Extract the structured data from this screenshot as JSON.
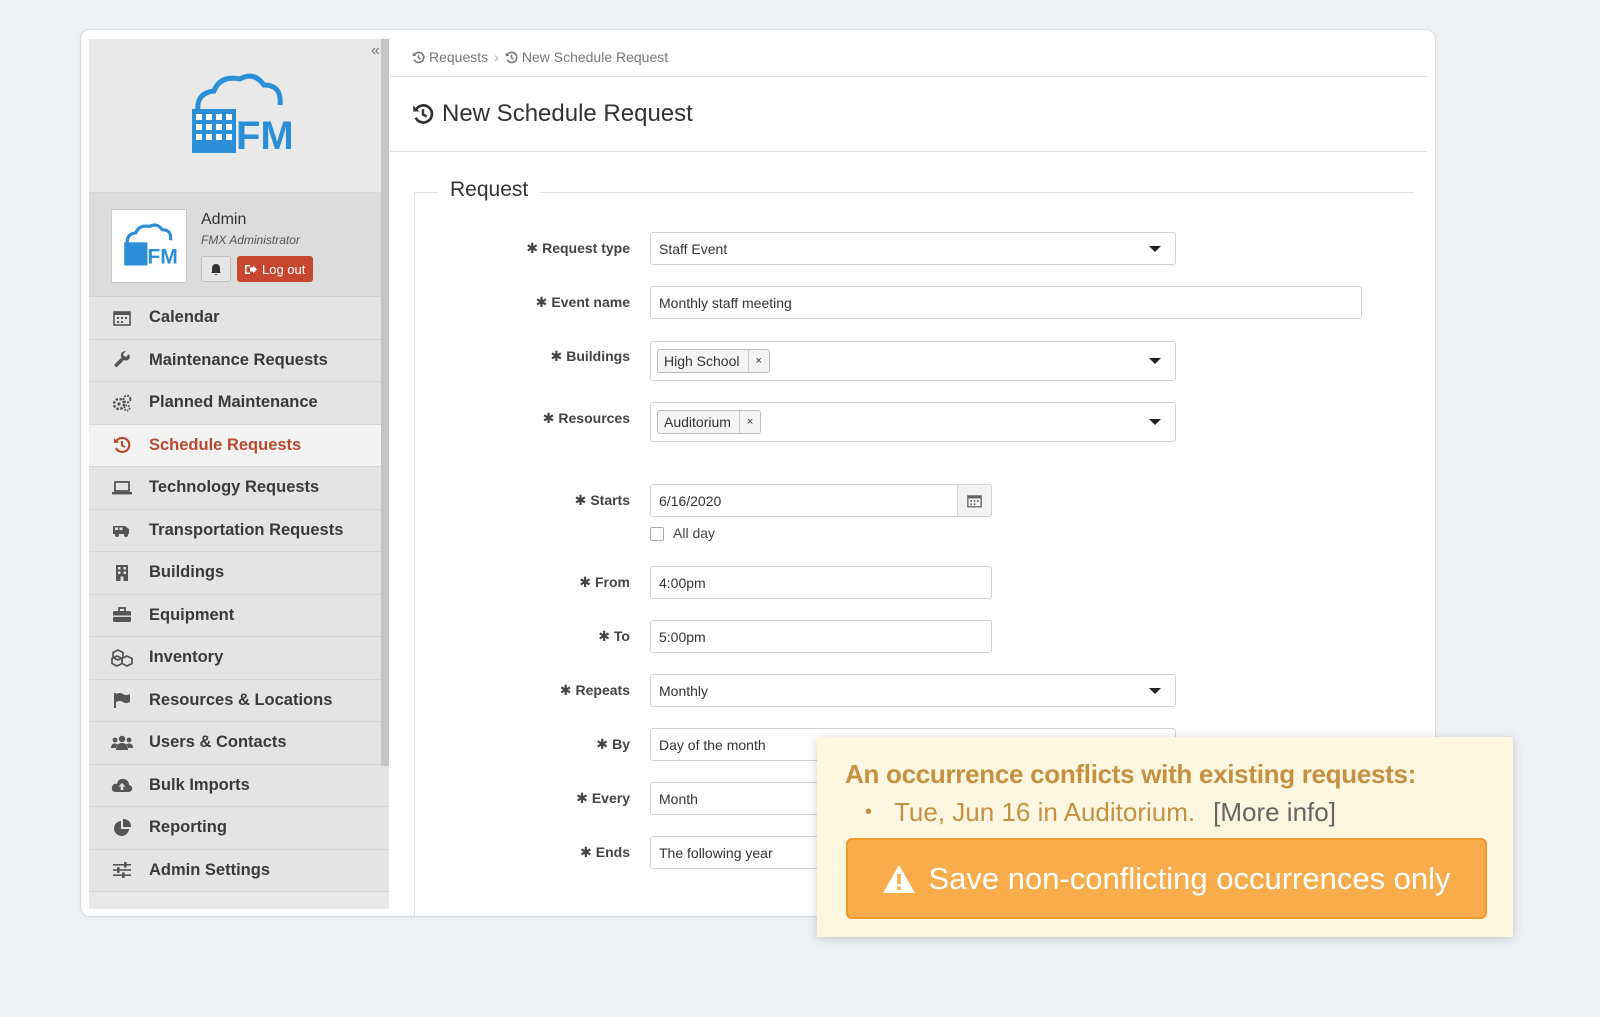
{
  "sidebar": {
    "collapse_icon": "«",
    "logo_text": "FMX",
    "user": {
      "name": "Admin",
      "role": "FMX Administrator",
      "logout_label": "Log out"
    },
    "items": [
      {
        "label": "Calendar",
        "icon": "calendar-icon"
      },
      {
        "label": "Maintenance Requests",
        "icon": "wrench-icon"
      },
      {
        "label": "Planned Maintenance",
        "icon": "gears-icon"
      },
      {
        "label": "Schedule Requests",
        "icon": "history-icon",
        "active": true
      },
      {
        "label": "Technology Requests",
        "icon": "laptop-icon"
      },
      {
        "label": "Transportation Requests",
        "icon": "bus-icon"
      },
      {
        "label": "Buildings",
        "icon": "building-icon"
      },
      {
        "label": "Equipment",
        "icon": "briefcase-icon"
      },
      {
        "label": "Inventory",
        "icon": "cubes-icon"
      },
      {
        "label": "Resources & Locations",
        "icon": "flag-icon"
      },
      {
        "label": "Users & Contacts",
        "icon": "users-icon"
      },
      {
        "label": "Bulk Imports",
        "icon": "cloud-upload-icon"
      },
      {
        "label": "Reporting",
        "icon": "pie-chart-icon"
      },
      {
        "label": "Admin Settings",
        "icon": "sliders-icon"
      }
    ]
  },
  "breadcrumb": {
    "items": [
      "Requests",
      "New Schedule Request"
    ],
    "separator": "›"
  },
  "page_title": "New Schedule Request",
  "form": {
    "legend": "Request",
    "required_mark": "✱",
    "request_type": {
      "label": "Request type",
      "value": "Staff Event"
    },
    "event_name": {
      "label": "Event name",
      "value": "Monthly staff meeting"
    },
    "buildings": {
      "label": "Buildings",
      "tag": "High School",
      "remove": "×"
    },
    "resources": {
      "label": "Resources",
      "tag": "Auditorium",
      "remove": "×"
    },
    "starts": {
      "label": "Starts",
      "value": "6/16/2020"
    },
    "all_day": {
      "label": "All day",
      "checked": false
    },
    "from": {
      "label": "From",
      "value": "4:00pm"
    },
    "to": {
      "label": "To",
      "value": "5:00pm"
    },
    "repeats": {
      "label": "Repeats",
      "value": "Monthly"
    },
    "by": {
      "label": "By",
      "value": "Day of the month"
    },
    "every": {
      "label": "Every",
      "value": "Month"
    },
    "ends": {
      "label": "Ends",
      "value": "The following year"
    }
  },
  "conflict_alert": {
    "title": "An occurrence conflicts with existing requests:",
    "bullet": "•",
    "item": "Tue, Jun 16 in Auditorium.",
    "more_info": "[More info]",
    "button_label": "Save non-conflicting occurrences only",
    "colors": {
      "background": "#fdf6e0",
      "text": "#c59142",
      "button": "#f9ac4b"
    }
  },
  "colors": {
    "active_nav": "#b94a2f",
    "logout": "#c74630",
    "logo_blue": "#2a8fd6"
  }
}
